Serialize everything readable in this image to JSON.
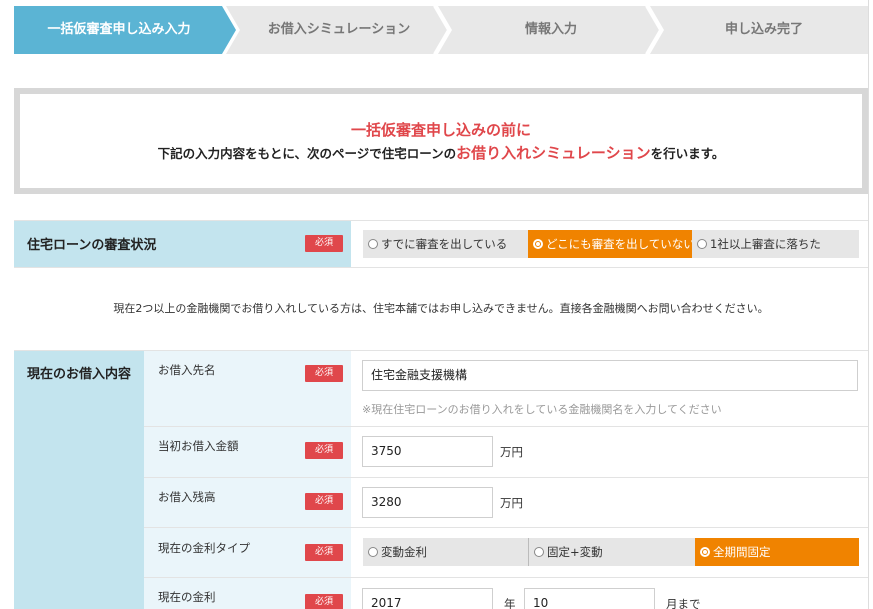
{
  "stepper": {
    "steps": [
      {
        "label": "一括仮審査申し込み入力",
        "active": true
      },
      {
        "label": "お借入シミュレーション",
        "active": false
      },
      {
        "label": "情報入力",
        "active": false
      },
      {
        "label": "申し込み完了",
        "active": false
      }
    ]
  },
  "intro": {
    "title": "一括仮審査申し込みの前に",
    "line_before": "下記の入力内容をもとに、次のページで住宅ローンの",
    "line_highlight": "お借り入れシミュレーション",
    "line_after": "を行います。"
  },
  "required_label": "必須",
  "loan_status": {
    "label": "住宅ローンの審査状況",
    "options": [
      {
        "label": "すでに審査を出している",
        "selected": false
      },
      {
        "label": "どこにも審査を出していない",
        "selected": true
      },
      {
        "label": "1社以上審査に落ちた",
        "selected": false
      }
    ]
  },
  "notice": "現在2つ以上の金融機関でお借り入れしている方は、住宅本舗ではお申し込みできません。直接各金融機関へお問い合わせください。",
  "current_loan": {
    "label": "現在のお借入内容",
    "lender": {
      "label": "お借入先名",
      "value": "住宅金融支援機構",
      "hint": "※現在住宅ローンのお借り入れをしている金融機関名を入力してください"
    },
    "initial_amount": {
      "label": "当初お借入金額",
      "value": "3750",
      "unit": "万円"
    },
    "balance": {
      "label": "お借入残高",
      "value": "3280",
      "unit": "万円"
    },
    "rate_type": {
      "label": "現在の金利タイプ",
      "options": [
        {
          "label": "変動金利",
          "selected": false
        },
        {
          "label": "固定+変動",
          "selected": false
        },
        {
          "label": "全期間固定",
          "selected": true
        }
      ]
    },
    "rate": {
      "label": "現在の金利",
      "year_value": "2017",
      "year_unit": "年",
      "month_value": "10",
      "month_unit": "月まで"
    }
  },
  "colors": {
    "active_step": "#5bb4d4",
    "inactive_step": "#e8e8e8",
    "accent_red": "#e0474b",
    "selected_orange": "#f08300",
    "label_blue": "#c3e4ee"
  }
}
